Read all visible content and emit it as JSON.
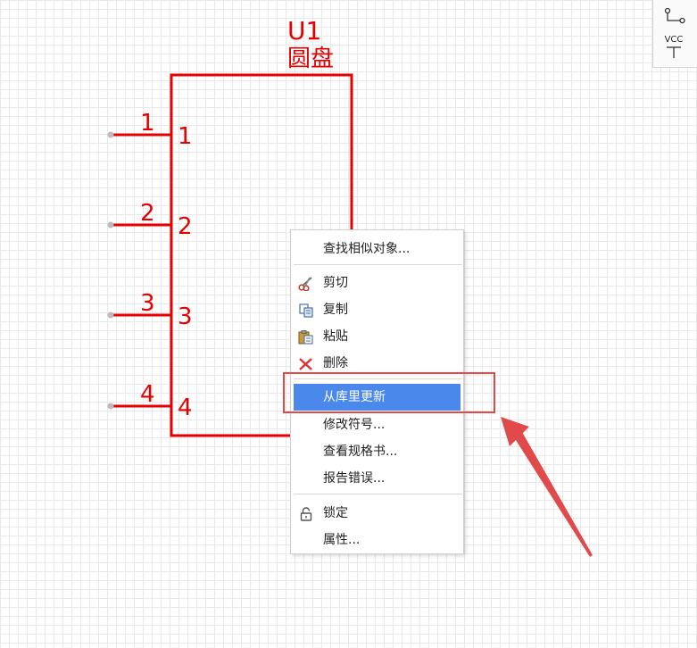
{
  "component": {
    "designator": "U1",
    "name": "圆盘",
    "pins": [
      {
        "outer": "1",
        "inner": "1"
      },
      {
        "outer": "2",
        "inner": "2"
      },
      {
        "outer": "3",
        "inner": "3"
      },
      {
        "outer": "4",
        "inner": "4"
      }
    ]
  },
  "toolbar": {
    "vcc_label": "VCC"
  },
  "context_menu": {
    "items": [
      {
        "label": "查找相似对象...",
        "icon": ""
      },
      {
        "label": "剪切",
        "icon": "scissors-icon"
      },
      {
        "label": "复制",
        "icon": "copy-icon"
      },
      {
        "label": "粘贴",
        "icon": "paste-icon"
      },
      {
        "label": "删除",
        "icon": "delete-x-icon"
      },
      {
        "label": "从库里更新",
        "icon": "",
        "highlighted": true
      },
      {
        "label": "修改符号...",
        "icon": ""
      },
      {
        "label": "查看规格书...",
        "icon": ""
      },
      {
        "label": "报告错误...",
        "icon": ""
      },
      {
        "label": "锁定",
        "icon": "lock-icon"
      },
      {
        "label": "属性...",
        "icon": ""
      }
    ]
  },
  "colors": {
    "schematic_red": "#e60000",
    "highlight_blue": "#4a88ec",
    "annotation_red": "#e14a4a"
  }
}
